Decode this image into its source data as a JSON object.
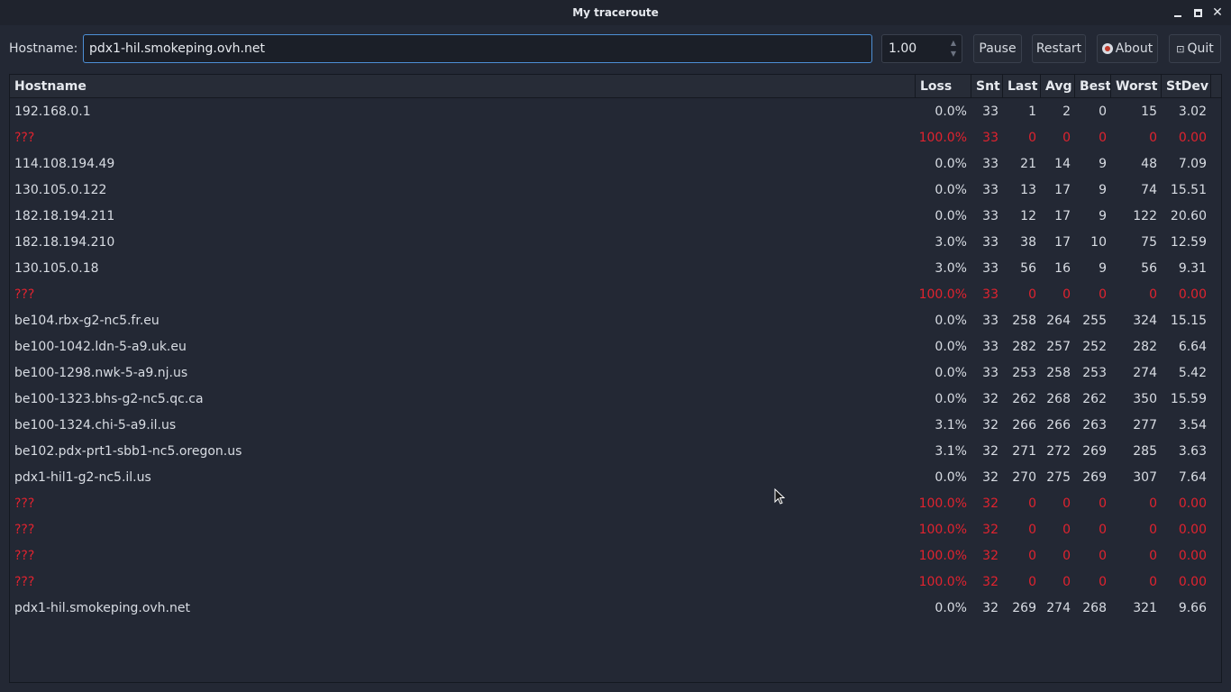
{
  "window": {
    "title": "My traceroute"
  },
  "toolbar": {
    "hostname_label": "Hostname:",
    "hostname_value": "pdx1-hil.smokeping.ovh.net",
    "interval_value": "1.00",
    "pause_label": "Pause",
    "restart_label": "Restart",
    "about_label": "About",
    "quit_label": "Quit"
  },
  "table": {
    "headers": {
      "hostname": "Hostname",
      "loss": "Loss",
      "snt": "Snt",
      "last": "Last",
      "avg": "Avg",
      "best": "Best",
      "worst": "Worst",
      "stdev": "StDev"
    },
    "rows": [
      {
        "host": "192.168.0.1",
        "loss": "0.0%",
        "snt": "33",
        "last": "1",
        "avg": "2",
        "best": "0",
        "worst": "15",
        "stdev": "3.02",
        "error": false
      },
      {
        "host": "???",
        "loss": "100.0%",
        "snt": "33",
        "last": "0",
        "avg": "0",
        "best": "0",
        "worst": "0",
        "stdev": "0.00",
        "error": true
      },
      {
        "host": "114.108.194.49",
        "loss": "0.0%",
        "snt": "33",
        "last": "21",
        "avg": "14",
        "best": "9",
        "worst": "48",
        "stdev": "7.09",
        "error": false
      },
      {
        "host": "130.105.0.122",
        "loss": "0.0%",
        "snt": "33",
        "last": "13",
        "avg": "17",
        "best": "9",
        "worst": "74",
        "stdev": "15.51",
        "error": false
      },
      {
        "host": "182.18.194.211",
        "loss": "0.0%",
        "snt": "33",
        "last": "12",
        "avg": "17",
        "best": "9",
        "worst": "122",
        "stdev": "20.60",
        "error": false
      },
      {
        "host": "182.18.194.210",
        "loss": "3.0%",
        "snt": "33",
        "last": "38",
        "avg": "17",
        "best": "10",
        "worst": "75",
        "stdev": "12.59",
        "error": false
      },
      {
        "host": "130.105.0.18",
        "loss": "3.0%",
        "snt": "33",
        "last": "56",
        "avg": "16",
        "best": "9",
        "worst": "56",
        "stdev": "9.31",
        "error": false
      },
      {
        "host": "???",
        "loss": "100.0%",
        "snt": "33",
        "last": "0",
        "avg": "0",
        "best": "0",
        "worst": "0",
        "stdev": "0.00",
        "error": true
      },
      {
        "host": "be104.rbx-g2-nc5.fr.eu",
        "loss": "0.0%",
        "snt": "33",
        "last": "258",
        "avg": "264",
        "best": "255",
        "worst": "324",
        "stdev": "15.15",
        "error": false
      },
      {
        "host": "be100-1042.ldn-5-a9.uk.eu",
        "loss": "0.0%",
        "snt": "33",
        "last": "282",
        "avg": "257",
        "best": "252",
        "worst": "282",
        "stdev": "6.64",
        "error": false
      },
      {
        "host": "be100-1298.nwk-5-a9.nj.us",
        "loss": "0.0%",
        "snt": "33",
        "last": "253",
        "avg": "258",
        "best": "253",
        "worst": "274",
        "stdev": "5.42",
        "error": false
      },
      {
        "host": "be100-1323.bhs-g2-nc5.qc.ca",
        "loss": "0.0%",
        "snt": "32",
        "last": "262",
        "avg": "268",
        "best": "262",
        "worst": "350",
        "stdev": "15.59",
        "error": false
      },
      {
        "host": "be100-1324.chi-5-a9.il.us",
        "loss": "3.1%",
        "snt": "32",
        "last": "266",
        "avg": "266",
        "best": "263",
        "worst": "277",
        "stdev": "3.54",
        "error": false
      },
      {
        "host": "be102.pdx-prt1-sbb1-nc5.oregon.us",
        "loss": "3.1%",
        "snt": "32",
        "last": "271",
        "avg": "272",
        "best": "269",
        "worst": "285",
        "stdev": "3.63",
        "error": false
      },
      {
        "host": "pdx1-hil1-g2-nc5.il.us",
        "loss": "0.0%",
        "snt": "32",
        "last": "270",
        "avg": "275",
        "best": "269",
        "worst": "307",
        "stdev": "7.64",
        "error": false
      },
      {
        "host": "???",
        "loss": "100.0%",
        "snt": "32",
        "last": "0",
        "avg": "0",
        "best": "0",
        "worst": "0",
        "stdev": "0.00",
        "error": true
      },
      {
        "host": "???",
        "loss": "100.0%",
        "snt": "32",
        "last": "0",
        "avg": "0",
        "best": "0",
        "worst": "0",
        "stdev": "0.00",
        "error": true
      },
      {
        "host": "???",
        "loss": "100.0%",
        "snt": "32",
        "last": "0",
        "avg": "0",
        "best": "0",
        "worst": "0",
        "stdev": "0.00",
        "error": true
      },
      {
        "host": "???",
        "loss": "100.0%",
        "snt": "32",
        "last": "0",
        "avg": "0",
        "best": "0",
        "worst": "0",
        "stdev": "0.00",
        "error": true
      },
      {
        "host": "pdx1-hil.smokeping.ovh.net",
        "loss": "0.0%",
        "snt": "32",
        "last": "269",
        "avg": "274",
        "best": "268",
        "worst": "321",
        "stdev": "9.66",
        "error": false
      }
    ]
  },
  "colors": {
    "error_row": "#e0232f",
    "focus_border": "#4d8fd6",
    "background": "#232834"
  },
  "icons": {
    "about": "about-lifebuoy-icon",
    "quit": "quit-exit-icon"
  }
}
